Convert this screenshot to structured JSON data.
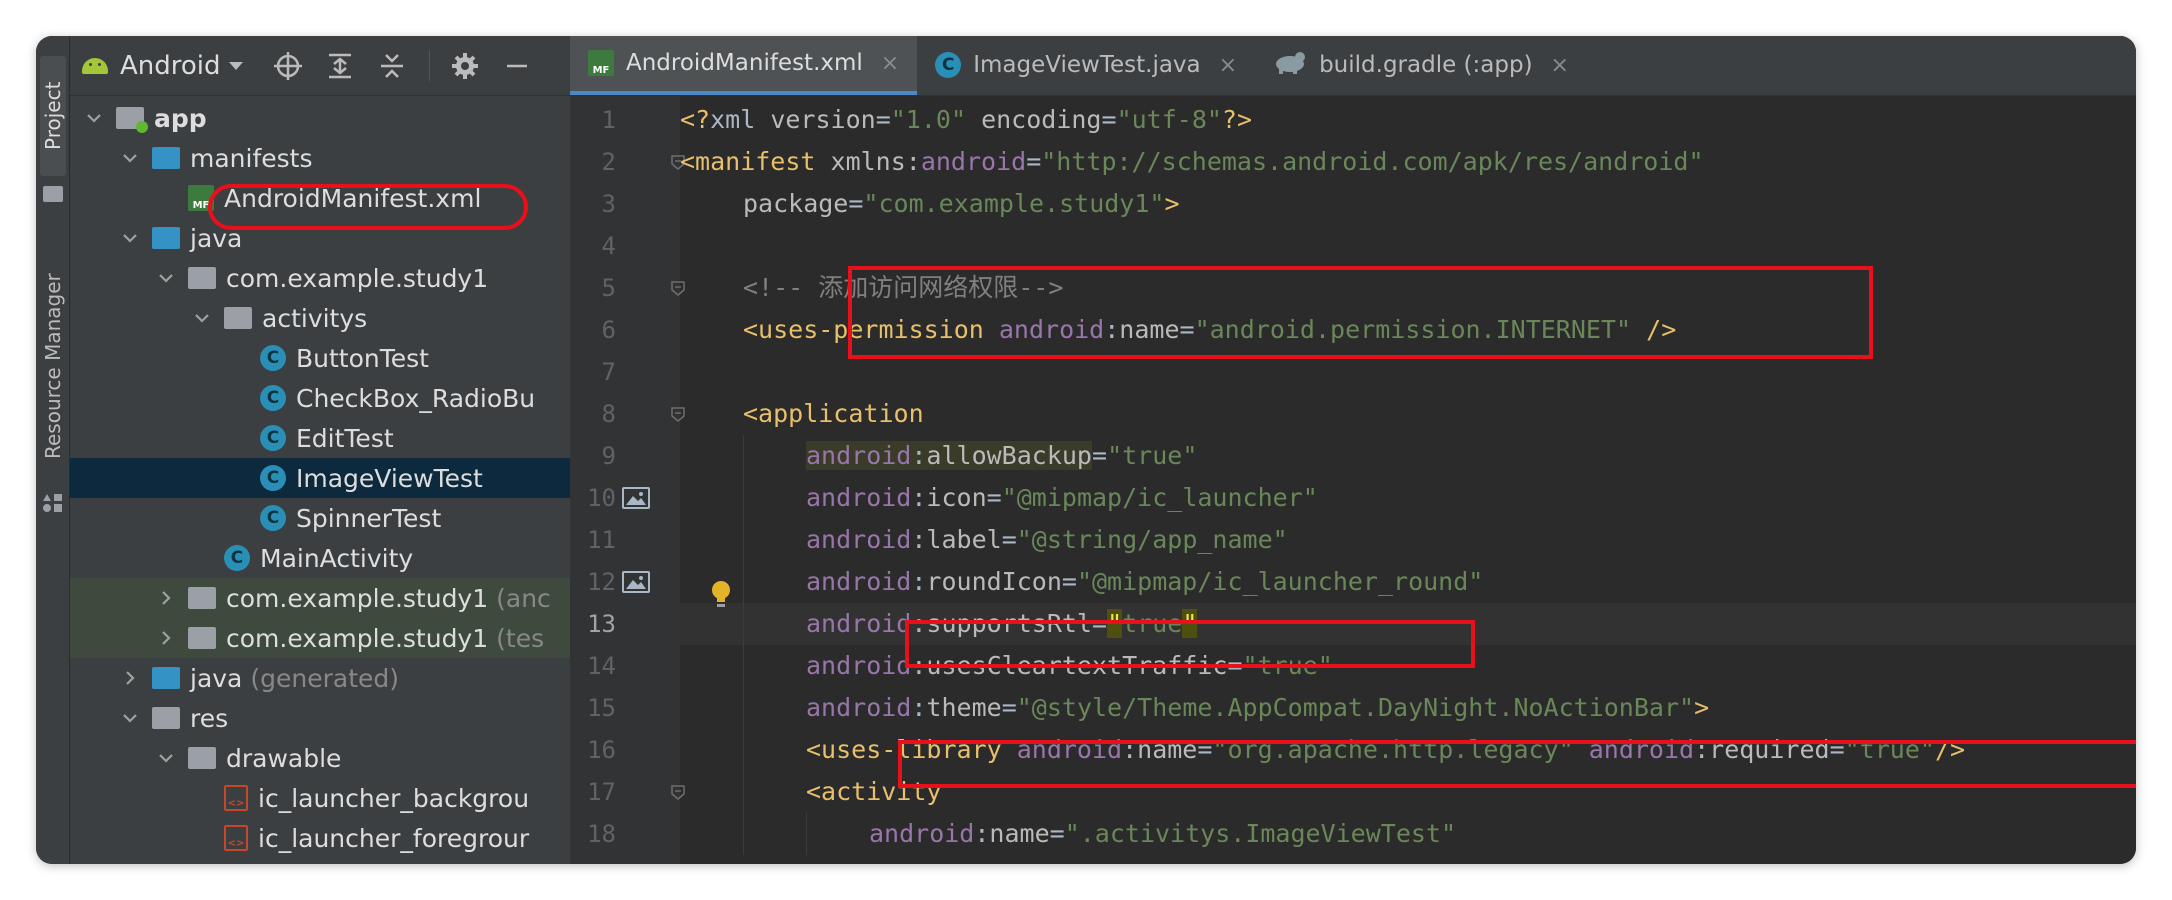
{
  "sidebar_strip": {
    "project_tab": "Project",
    "resource_manager_tab": "Resource Manager"
  },
  "project_panel": {
    "view_selector": "Android",
    "tree": [
      {
        "label": "app",
        "suffix": "",
        "level": 0,
        "expanded": true,
        "icon": "app-module-icon"
      },
      {
        "label": "manifests",
        "suffix": "",
        "level": 1,
        "expanded": true,
        "icon": "folder-icon"
      },
      {
        "label": "AndroidManifest.xml",
        "suffix": "",
        "level": 2,
        "icon": "manifest-file-icon"
      },
      {
        "label": "java",
        "suffix": "",
        "level": 1,
        "expanded": true,
        "icon": "folder-icon"
      },
      {
        "label": "com.example.study1",
        "suffix": "",
        "level": 2,
        "expanded": true,
        "icon": "package-icon"
      },
      {
        "label": "activitys",
        "suffix": "",
        "level": 3,
        "expanded": true,
        "icon": "package-icon"
      },
      {
        "label": "ButtonTest",
        "suffix": "",
        "level": 4,
        "icon": "class-icon"
      },
      {
        "label": "CheckBox_RadioBu",
        "suffix": "",
        "level": 4,
        "icon": "class-icon"
      },
      {
        "label": "EditTest",
        "suffix": "",
        "level": 4,
        "icon": "class-icon"
      },
      {
        "label": "ImageViewTest",
        "suffix": "",
        "level": 4,
        "icon": "class-icon",
        "selected": true
      },
      {
        "label": "SpinnerTest",
        "suffix": "",
        "level": 4,
        "icon": "class-icon"
      },
      {
        "label": "MainActivity",
        "suffix": "",
        "level": 3,
        "icon": "class-icon"
      },
      {
        "label": "com.example.study1",
        "suffix": "(anc",
        "level": 2,
        "expanded": false,
        "icon": "package-icon"
      },
      {
        "label": "com.example.study1",
        "suffix": "(tes",
        "level": 2,
        "expanded": false,
        "icon": "package-icon"
      },
      {
        "label": "java",
        "suffix": "(generated)",
        "level": 1,
        "expanded": false,
        "icon": "generated-folder-icon"
      },
      {
        "label": "res",
        "suffix": "",
        "level": 1,
        "expanded": true,
        "icon": "res-folder-icon"
      },
      {
        "label": "drawable",
        "suffix": "",
        "level": 2,
        "expanded": true,
        "icon": "package-icon"
      },
      {
        "label": "ic_launcher_backgrou",
        "suffix": "",
        "level": 3,
        "icon": "xml-file-icon"
      },
      {
        "label": "ic_launcher_foregrour",
        "suffix": "",
        "level": 3,
        "icon": "xml-file-icon"
      }
    ]
  },
  "editor": {
    "tabs": [
      {
        "label": "AndroidManifest.xml",
        "icon": "manifest-file-icon",
        "active": true
      },
      {
        "label": "ImageViewTest.java",
        "icon": "class-icon",
        "active": false
      },
      {
        "label": "build.gradle (:app)",
        "icon": "gradle-icon",
        "active": false
      }
    ],
    "close_glyph": "×",
    "current_line": 13,
    "lines": [
      {
        "no": "1",
        "indent": 0,
        "tokens": [
          [
            "t-tag",
            "<?"
          ],
          [
            "t-punct",
            "xml "
          ],
          [
            "t-attr",
            "version"
          ],
          [
            "t-punct",
            "="
          ],
          [
            "t-val",
            "\"1.0\""
          ],
          [
            "t-punct",
            " "
          ],
          [
            "t-attr",
            "encoding"
          ],
          [
            "t-punct",
            "="
          ],
          [
            "t-val",
            "\"utf-8\""
          ],
          [
            "t-tag",
            "?>"
          ]
        ]
      },
      {
        "no": "2",
        "indent": 0,
        "tokens": [
          [
            "t-tag",
            "<manifest "
          ],
          [
            "t-attr",
            "xmlns:"
          ],
          [
            "t-ns",
            "android"
          ],
          [
            "t-punct",
            "="
          ],
          [
            "t-val",
            "\"http://schemas.android.com/apk/res/android\""
          ]
        ]
      },
      {
        "no": "3",
        "indent": 1,
        "tokens": [
          [
            "t-attr",
            "package"
          ],
          [
            "t-punct",
            "="
          ],
          [
            "t-val",
            "\"com.example.study1\""
          ],
          [
            "t-tag",
            ">"
          ]
        ]
      },
      {
        "no": "4",
        "indent": 0,
        "tokens": []
      },
      {
        "no": "5",
        "indent": 1,
        "tokens": [
          [
            "t-cmt",
            "<!-- 添加访问网络权限-->"
          ]
        ]
      },
      {
        "no": "6",
        "indent": 1,
        "tokens": [
          [
            "t-tag",
            "<uses-permission "
          ],
          [
            "t-ns",
            "android"
          ],
          [
            "t-punct",
            ":"
          ],
          [
            "t-attr",
            "name"
          ],
          [
            "t-punct",
            "="
          ],
          [
            "t-val",
            "\"android.permission.INTERNET\""
          ],
          [
            "t-punct",
            " "
          ],
          [
            "t-tag",
            "/>"
          ]
        ]
      },
      {
        "no": "7",
        "indent": 0,
        "tokens": []
      },
      {
        "no": "8",
        "indent": 1,
        "tokens": [
          [
            "t-tag",
            "<application"
          ]
        ]
      },
      {
        "no": "9",
        "indent": 2,
        "tokens": [
          [
            "t-ns hl-attr",
            "android"
          ],
          [
            "t-punct hl-attr",
            ":"
          ],
          [
            "t-attr hl-attr",
            "allowBackup"
          ],
          [
            "t-punct",
            "="
          ],
          [
            "t-val",
            "\"true\""
          ]
        ]
      },
      {
        "no": "10",
        "indent": 2,
        "tokens": [
          [
            "t-ns",
            "android"
          ],
          [
            "t-punct",
            ":"
          ],
          [
            "t-attr",
            "icon"
          ],
          [
            "t-punct",
            "="
          ],
          [
            "t-val",
            "\"@mipmap/ic_launcher\""
          ]
        ]
      },
      {
        "no": "11",
        "indent": 2,
        "tokens": [
          [
            "t-ns",
            "android"
          ],
          [
            "t-punct",
            ":"
          ],
          [
            "t-attr",
            "label"
          ],
          [
            "t-punct",
            "="
          ],
          [
            "t-val",
            "\"@string/app_name\""
          ]
        ]
      },
      {
        "no": "12",
        "indent": 2,
        "tokens": [
          [
            "t-ns",
            "android"
          ],
          [
            "t-punct",
            ":"
          ],
          [
            "t-attr",
            "roundIcon"
          ],
          [
            "t-punct",
            "="
          ],
          [
            "t-val",
            "\"@mipmap/ic_launcher_round\""
          ]
        ]
      },
      {
        "no": "13",
        "indent": 2,
        "tokens": [
          [
            "t-ns",
            "android"
          ],
          [
            "t-punct",
            ":"
          ],
          [
            "t-attr",
            "supportsRtl"
          ],
          [
            "t-punct",
            "="
          ],
          [
            "hl-quote",
            "\""
          ],
          [
            "t-val",
            "true"
          ],
          [
            "hl-quote",
            "\""
          ]
        ]
      },
      {
        "no": "14",
        "indent": 2,
        "tokens": [
          [
            "t-ns",
            "android"
          ],
          [
            "t-punct",
            ":"
          ],
          [
            "t-attr",
            "usesCleartextTraffic"
          ],
          [
            "t-punct",
            "="
          ],
          [
            "t-val",
            "\"true\""
          ]
        ]
      },
      {
        "no": "15",
        "indent": 2,
        "tokens": [
          [
            "t-ns",
            "android"
          ],
          [
            "t-punct",
            ":"
          ],
          [
            "t-attr",
            "theme"
          ],
          [
            "t-punct",
            "="
          ],
          [
            "t-val",
            "\"@style/Theme.AppCompat.DayNight.NoActionBar\""
          ],
          [
            "t-tag",
            ">"
          ]
        ]
      },
      {
        "no": "16",
        "indent": 2,
        "tokens": [
          [
            "t-tag",
            "<uses-library "
          ],
          [
            "t-ns",
            "android"
          ],
          [
            "t-punct",
            ":"
          ],
          [
            "t-attr",
            "name"
          ],
          [
            "t-punct",
            "="
          ],
          [
            "t-val",
            "\"org.apache.http.legacy\""
          ],
          [
            "t-punct",
            " "
          ],
          [
            "t-ns",
            "android"
          ],
          [
            "t-punct",
            ":"
          ],
          [
            "t-attr",
            "required"
          ],
          [
            "t-punct",
            "="
          ],
          [
            "t-val",
            "\"true\""
          ],
          [
            "t-tag",
            "/>"
          ]
        ]
      },
      {
        "no": "17",
        "indent": 2,
        "tokens": [
          [
            "t-tag",
            "<activity"
          ]
        ]
      },
      {
        "no": "18",
        "indent": 3,
        "tokens": [
          [
            "t-ns",
            "android"
          ],
          [
            "t-punct",
            ":"
          ],
          [
            "t-attr",
            "name"
          ],
          [
            "t-punct",
            "="
          ],
          [
            "t-val",
            "\".activitys.ImageViewTest\""
          ]
        ]
      }
    ]
  },
  "colors": {
    "highlight_border": "#e8101a",
    "editor_bg": "#2b2b2b",
    "panel_bg": "#3c3f41",
    "selected_row": "#0d293e"
  }
}
